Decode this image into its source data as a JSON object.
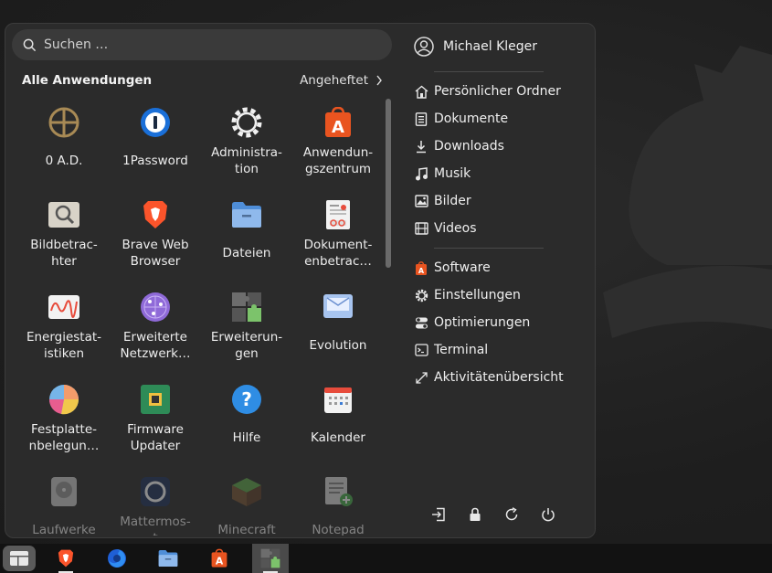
{
  "search": {
    "placeholder": "Suchen …"
  },
  "section": {
    "title": "Alle Anwendungen",
    "pinned_label": "Angeheftet"
  },
  "apps": [
    {
      "label": "0 A.D.",
      "icon": "0ad-icon"
    },
    {
      "label": "1Password",
      "icon": "1password-icon"
    },
    {
      "label": "Administra-\ntion",
      "icon": "administration-gear-icon"
    },
    {
      "label": "Anwendun-\ngszentrum",
      "icon": "app-center-icon"
    },
    {
      "label": "Bildbetrac-\nhter",
      "icon": "image-viewer-icon"
    },
    {
      "label": "Brave Web\nBrowser",
      "icon": "brave-icon"
    },
    {
      "label": "Dateien",
      "icon": "files-folder-icon"
    },
    {
      "label": "Dokument-\nenbetrac…",
      "icon": "document-viewer-icon"
    },
    {
      "label": "Energiestat-\nistiken",
      "icon": "power-statistics-icon"
    },
    {
      "label": "Erweiterte\nNetzwerk…",
      "icon": "network-icon"
    },
    {
      "label": "Erweiterun-\ngen",
      "icon": "extensions-puzzle-icon"
    },
    {
      "label": "Evolution",
      "icon": "evolution-mail-icon"
    },
    {
      "label": "Festplatte-\nnbelegun…",
      "icon": "disk-usage-icon"
    },
    {
      "label": "Firmware\nUpdater",
      "icon": "firmware-chip-icon"
    },
    {
      "label": "Hilfe",
      "icon": "help-icon"
    },
    {
      "label": "Kalender",
      "icon": "calendar-icon"
    },
    {
      "label": "Laufwerke",
      "icon": "disks-icon"
    },
    {
      "label": "Mattermos-\nt",
      "icon": "mattermost-icon"
    },
    {
      "label": "Minecraft",
      "icon": "minecraft-icon"
    },
    {
      "label": "Notepad",
      "icon": "notepad-icon"
    }
  ],
  "user": {
    "name": "Michael Kleger"
  },
  "places": [
    {
      "label": "Persönlicher Ordner",
      "icon": "home-icon"
    },
    {
      "label": "Dokumente",
      "icon": "document-icon"
    },
    {
      "label": "Downloads",
      "icon": "download-icon"
    },
    {
      "label": "Musik",
      "icon": "music-icon"
    },
    {
      "label": "Bilder",
      "icon": "picture-icon"
    },
    {
      "label": "Videos",
      "icon": "video-icon"
    }
  ],
  "system": [
    {
      "label": "Software",
      "icon": "software-icon"
    },
    {
      "label": "Einstellungen",
      "icon": "settings-icon"
    },
    {
      "label": "Optimierungen",
      "icon": "tweaks-icon"
    },
    {
      "label": "Terminal",
      "icon": "terminal-icon"
    },
    {
      "label": "Aktivitätenübersicht",
      "icon": "activities-icon"
    }
  ],
  "colors": {
    "accent_orange": "#e95420",
    "panel_bg": "#2b2b2b",
    "taskbar_bg": "#121212"
  }
}
